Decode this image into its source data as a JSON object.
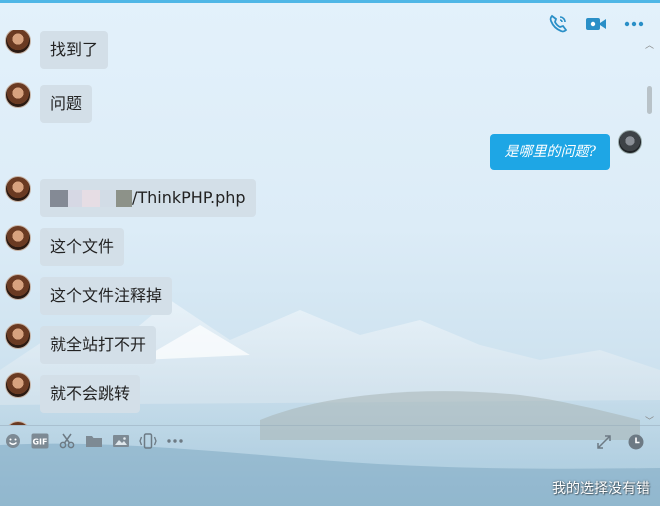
{
  "incoming": [
    {
      "text": "找到了"
    },
    {
      "text": "问题"
    },
    {
      "file_suffix": "/ThinkPHP.php"
    },
    {
      "text": "这个文件"
    },
    {
      "text": "这个文件注释掉"
    },
    {
      "text": "就全站打不开"
    },
    {
      "text": "就不会跳转"
    }
  ],
  "outgoing": {
    "text": "是哪里的问题?"
  },
  "header_icons": [
    "phone-call-icon",
    "video-call-icon",
    "more-icon"
  ],
  "toolbar_icons": [
    "emoji-icon",
    "gif-icon",
    "scissors-icon",
    "folder-icon",
    "image-icon",
    "shake-icon",
    "more-dots-icon"
  ],
  "toolbar_gif_label": "GIF",
  "toolbar_right_icons": [
    "expand-icon",
    "history-icon"
  ],
  "watermark": "我的选择没有错",
  "colors": {
    "accent": "#1ea6e5",
    "incoming_bubble": "#d3dfe8",
    "icon": "#2a8fc7"
  }
}
